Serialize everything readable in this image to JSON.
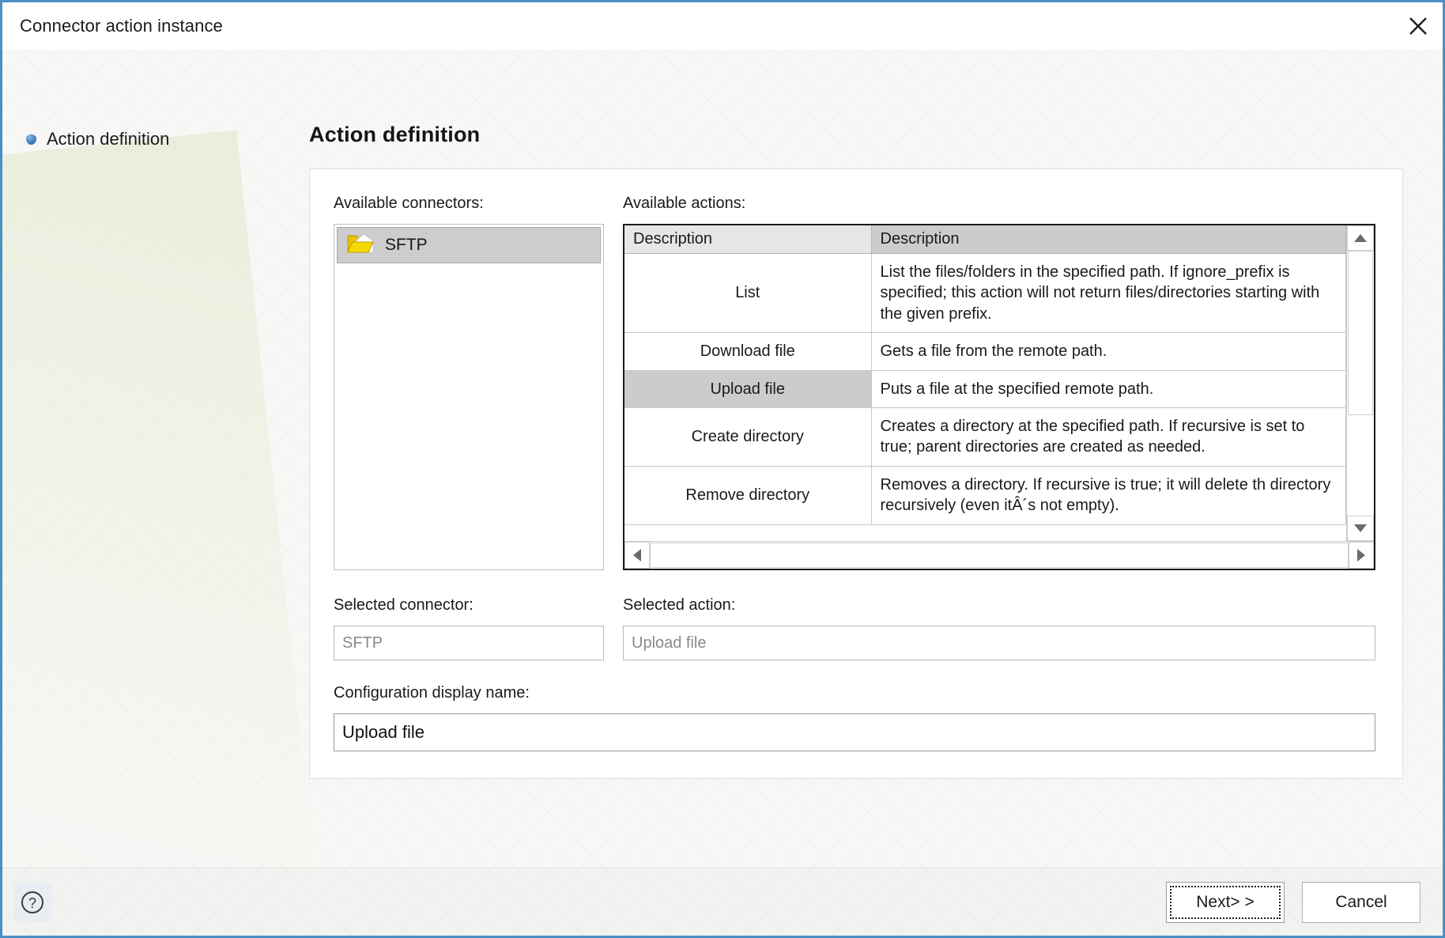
{
  "window": {
    "title": "Connector action instance",
    "close_icon": "close-icon"
  },
  "sidebar": {
    "items": [
      {
        "label": "Action definition",
        "icon": "bullet-diamond-icon",
        "active": true
      }
    ]
  },
  "main": {
    "page_title": "Action definition",
    "connectors": {
      "label": "Available connectors:",
      "items": [
        {
          "name": "SFTP",
          "icon": "folder-open-icon",
          "selected": true
        }
      ]
    },
    "actions": {
      "label": "Available actions:",
      "columns": [
        "Description",
        "Description"
      ],
      "rows": [
        {
          "name": "List",
          "description": "List the files/folders in the specified path. If ignore_prefix is specified; this action will not return files/directories starting with the given prefix.",
          "selected": false
        },
        {
          "name": "Download file",
          "description": "Gets a file from the remote path.",
          "selected": false
        },
        {
          "name": "Upload file",
          "description": "Puts a file at the specified remote path.",
          "selected": true
        },
        {
          "name": "Create directory",
          "description": "Creates a directory at the specified path. If recursive is set to true; parent directories are created as needed.",
          "selected": false
        },
        {
          "name": "Remove directory",
          "description": "Removes a directory. If recursive is true; it will delete th directory recursively (even itÂ´s not empty).",
          "selected": false
        }
      ],
      "scroll_up_icon": "triangle-up-icon",
      "scroll_down_icon": "triangle-down-icon",
      "scroll_left_icon": "triangle-left-icon",
      "scroll_right_icon": "triangle-right-icon"
    },
    "selected_connector": {
      "label": "Selected connector:",
      "value": "SFTP"
    },
    "selected_action": {
      "label": "Selected action:",
      "value": "Upload file"
    },
    "config_display_name": {
      "label": "Configuration display name:",
      "value": "Upload file"
    }
  },
  "footer": {
    "help_icon": "question-mark-icon",
    "next_label": "Next> >",
    "cancel_label": "Cancel"
  },
  "colors": {
    "window_border": "#4a90c4",
    "selection": "#cccccc",
    "folder": "#f2d000",
    "header": "#cccccc"
  }
}
